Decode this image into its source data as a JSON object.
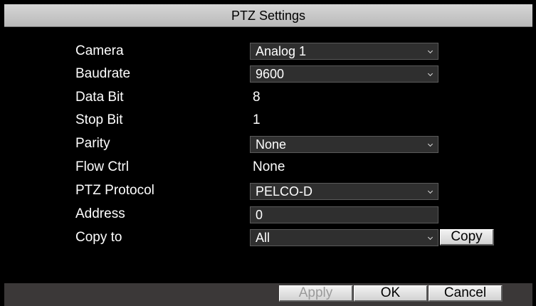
{
  "title": "PTZ Settings",
  "fields": {
    "camera": {
      "label": "Camera",
      "value": "Analog 1"
    },
    "baudrate": {
      "label": "Baudrate",
      "value": "9600"
    },
    "data_bit": {
      "label": "Data Bit",
      "value": "8"
    },
    "stop_bit": {
      "label": "Stop Bit",
      "value": "1"
    },
    "parity": {
      "label": "Parity",
      "value": "None"
    },
    "flow_ctrl": {
      "label": "Flow Ctrl",
      "value": "None"
    },
    "ptz_protocol": {
      "label": "PTZ Protocol",
      "value": "PELCO-D"
    },
    "address": {
      "label": "Address",
      "value": "0"
    },
    "copy_to": {
      "label": "Copy to",
      "value": "All"
    }
  },
  "buttons": {
    "copy": "Copy",
    "apply": "Apply",
    "ok": "OK",
    "cancel": "Cancel"
  },
  "icons": {
    "dropdown": "chevron-down-icon"
  },
  "colors": {
    "background": "#000000",
    "titlebar": "#c8c8c8",
    "field_bg": "#2f2f2f",
    "footer": "#3b3838",
    "button": "#e0e0e0"
  }
}
